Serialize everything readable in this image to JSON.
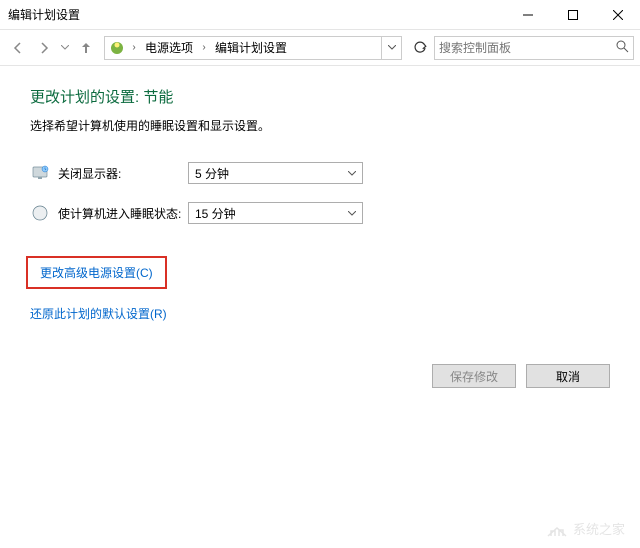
{
  "window": {
    "title": "编辑计划设置"
  },
  "breadcrumb": {
    "item1": "电源选项",
    "item2": "编辑计划设置"
  },
  "search": {
    "placeholder": "搜索控制面板"
  },
  "main": {
    "heading": "更改计划的设置: 节能",
    "description": "选择希望计算机使用的睡眠设置和显示设置。",
    "display_off_label": "关闭显示器:",
    "display_off_value": "5 分钟",
    "sleep_label": "使计算机进入睡眠状态:",
    "sleep_value": "15 分钟",
    "advanced_link": "更改高级电源设置(C)",
    "restore_link": "还原此计划的默认设置(R)"
  },
  "buttons": {
    "save": "保存修改",
    "cancel": "取消"
  },
  "watermark": {
    "text": "系统之家"
  }
}
